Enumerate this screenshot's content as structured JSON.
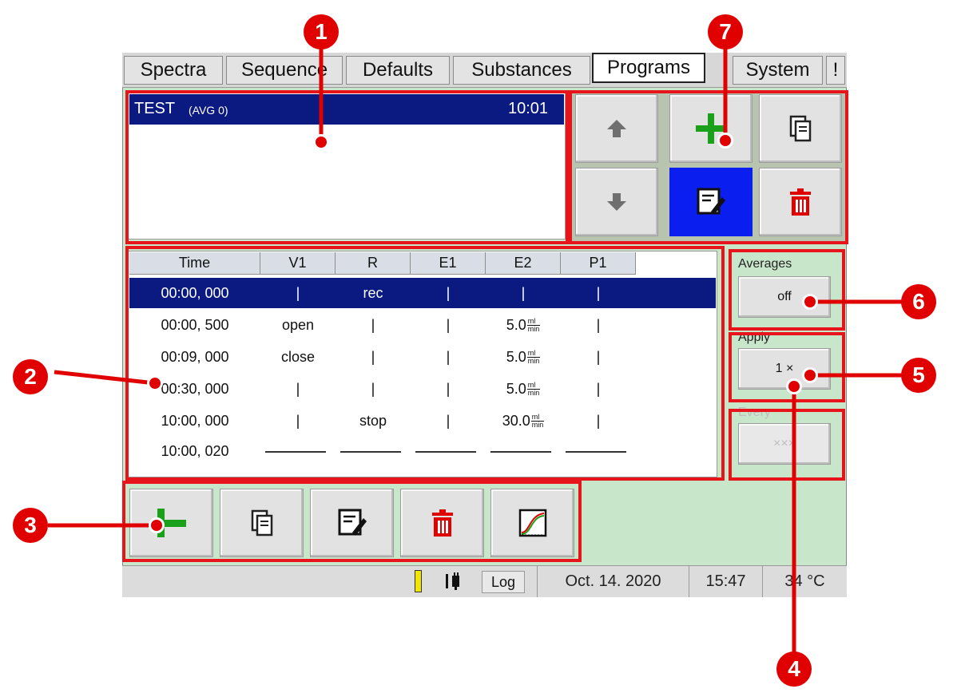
{
  "tabs": [
    "Spectra",
    "Sequence",
    "Defaults",
    "Substances",
    "Programs",
    "System",
    "!"
  ],
  "active_tab": "Programs",
  "program_list": {
    "selected": {
      "name": "TEST",
      "avg": "(AVG 0)",
      "time": "10:01"
    }
  },
  "table": {
    "headers": [
      "Time",
      "V1",
      "R",
      "E1",
      "E2",
      "P1"
    ],
    "rows": [
      [
        "00:00, 000",
        "|",
        "rec",
        "|",
        "|",
        "|"
      ],
      [
        "00:00, 500",
        "open",
        "|",
        "|",
        "5.0",
        "|"
      ],
      [
        "00:09, 000",
        "close",
        "|",
        "|",
        "5.0",
        "|"
      ],
      [
        "00:30, 000",
        "|",
        "|",
        "|",
        "5.0",
        "|"
      ],
      [
        "10:00, 000",
        "|",
        "stop",
        "|",
        "30.0",
        "|"
      ],
      [
        "10:00, 020",
        "",
        "",
        "",
        "",
        ""
      ]
    ],
    "unit_num": "ml",
    "unit_den": "min"
  },
  "side": {
    "averages_label": "Averages",
    "averages_value": "off",
    "apply_label": "Apply",
    "apply_value": "1 ×",
    "every_label": "Every",
    "every_value": "×××"
  },
  "status": {
    "log": "Log",
    "date": "Oct. 14. 2020",
    "time": "15:47",
    "temp": "34 °C"
  },
  "callouts": [
    "1",
    "2",
    "3",
    "4",
    "5",
    "6",
    "7"
  ],
  "colors": {
    "accent_blue": "#0a1ef0",
    "selection": "#0a1a80",
    "callout_red": "#e8141b",
    "background_green": "#c8e6c9",
    "add_green": "#1aa01a",
    "delete_red": "#e00000"
  },
  "icons": [
    "arrow-up-icon",
    "arrow-down-icon",
    "plus-icon",
    "copy-icon",
    "edit-icon",
    "trash-icon",
    "insert-step-icon",
    "graph-icon",
    "battery-icon",
    "plug-icon"
  ]
}
